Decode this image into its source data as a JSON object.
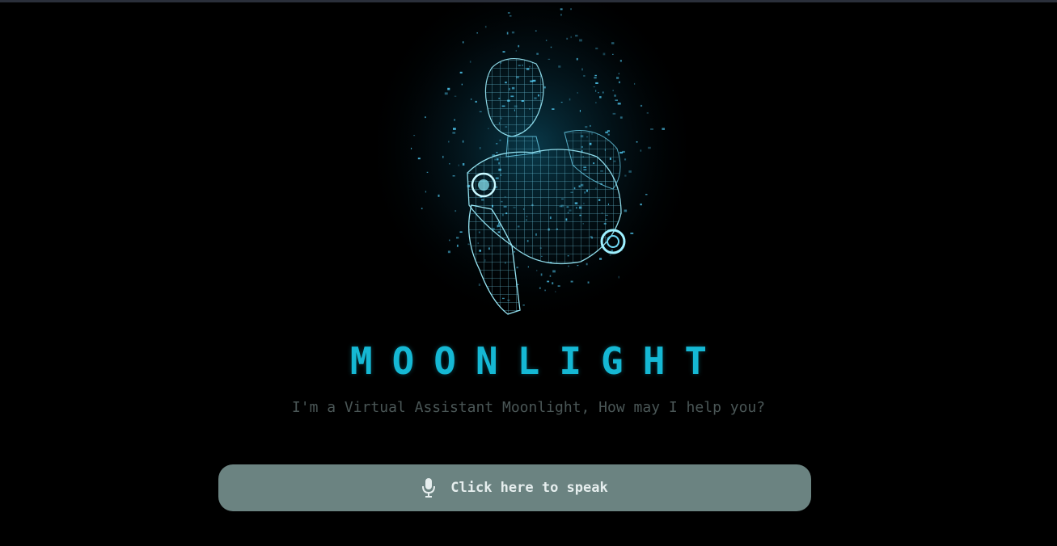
{
  "app": {
    "title": "MOONLIGHT",
    "subtitle": "I'm a Virtual Assistant Moonlight, How may I help you?"
  },
  "hero": {
    "image": "holographic-armor-figure"
  },
  "speak_button": {
    "label": "Click here to speak",
    "icon": "microphone-icon"
  },
  "colors": {
    "background": "#000000",
    "accent": "#15b8d4",
    "subtitle": "#4a5656",
    "button_bg": "#6b8381",
    "button_text": "#e6eeee"
  }
}
